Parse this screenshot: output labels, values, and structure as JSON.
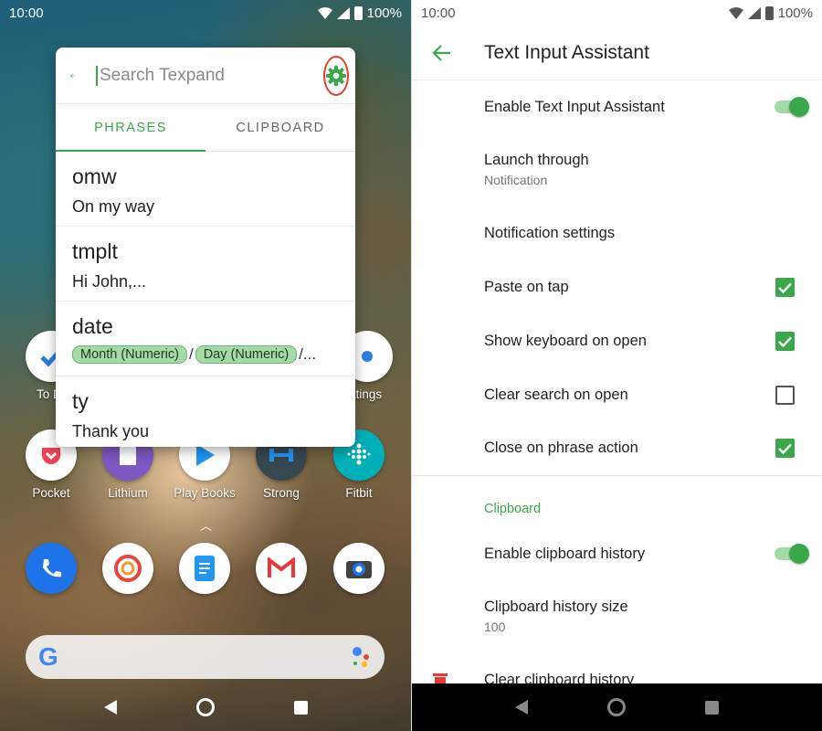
{
  "left": {
    "status": {
      "time": "10:00",
      "battery": "100%"
    },
    "popup": {
      "search_placeholder": "Search Texpand",
      "tabs": [
        "PHRASES",
        "CLIPBOARD"
      ],
      "phrases": [
        {
          "key": "omw",
          "value": "On my way"
        },
        {
          "key": "tmplt",
          "value": "Hi John,..."
        },
        {
          "key": "date",
          "chips": [
            "Month (Numeric)",
            "Day (Numeric)"
          ],
          "trail": "/..."
        },
        {
          "key": "ty",
          "value": "Thank you"
        }
      ]
    },
    "apps_row1": [
      {
        "label": "To D",
        "color": "#ffffff"
      },
      {
        "label": "ttings",
        "color": "#ffffff"
      }
    ],
    "apps_row2": [
      {
        "label": "Pocket",
        "color": "#ffffff"
      },
      {
        "label": "Lithium",
        "color": "#7e57c2"
      },
      {
        "label": "Play Books",
        "color": "#ffffff"
      },
      {
        "label": "Strong",
        "color": "#37474f"
      },
      {
        "label": "Fitbit",
        "color": "#00b0b9"
      }
    ],
    "dock_icons": [
      "phone-icon",
      "firefox-icon",
      "docs-icon",
      "gmail-icon",
      "camera-icon"
    ],
    "google_logo": "G"
  },
  "right": {
    "status": {
      "time": "10:00",
      "battery": "100%"
    },
    "title": "Text Input Assistant",
    "prefs": {
      "enable": "Enable Text Input Assistant",
      "launch_title": "Launch through",
      "launch_value": "Notification",
      "notif_settings": "Notification settings",
      "paste_on_tap": "Paste on tap",
      "show_keyboard": "Show keyboard on open",
      "clear_search": "Clear search on open",
      "close_on_action": "Close on phrase action"
    },
    "checkbox_states": {
      "paste_on_tap": true,
      "show_keyboard": true,
      "clear_search": false,
      "close_on_action": true
    },
    "clipboard_section": "Clipboard",
    "clipboard": {
      "enable_history": "Enable clipboard history",
      "history_size_title": "Clipboard history size",
      "history_size_value": "100",
      "clear_history": "Clear clipboard history"
    }
  },
  "colors": {
    "accent": "#3aa84a",
    "highlight_ring": "#e0402b"
  }
}
